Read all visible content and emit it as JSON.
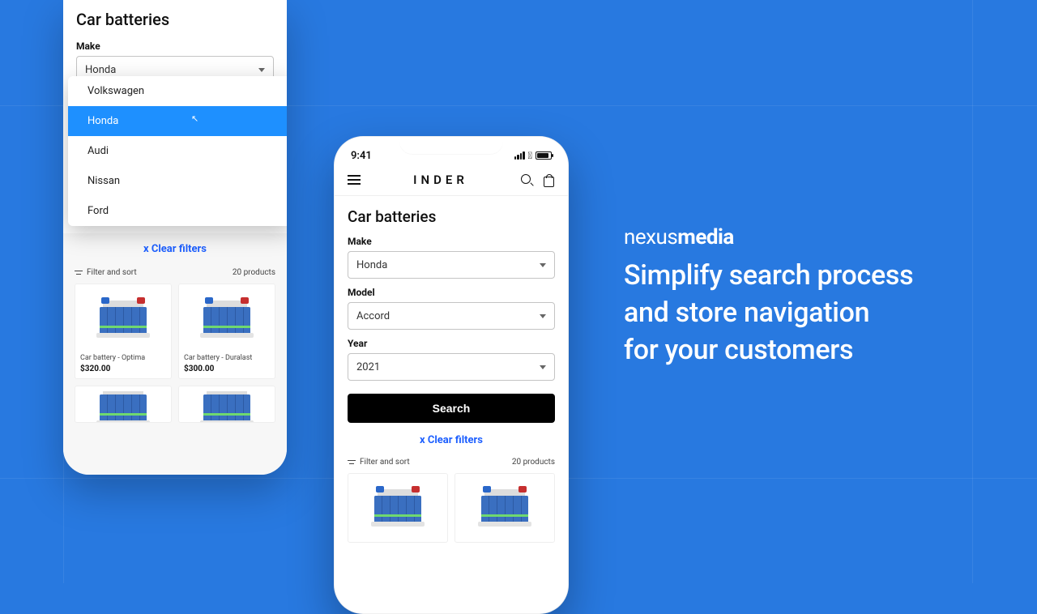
{
  "phone1": {
    "title": "Car batteries",
    "make_label": "Make",
    "make_value": "Honda",
    "dropdown": {
      "options": [
        "Volkswagen",
        "Honda",
        "Audi",
        "Nissan",
        "Ford"
      ],
      "selected_index": 1
    },
    "clear_filters": "x Clear filters",
    "filter_sort": "Filter and sort",
    "product_count": "20 products",
    "products": [
      {
        "name": "Car battery - Optima",
        "price": "$320.00"
      },
      {
        "name": "Car battery - Duralast",
        "price": "$300.00"
      }
    ]
  },
  "phone2": {
    "status_time": "9:41",
    "brand": "INDER",
    "title": "Car batteries",
    "fields": {
      "make": {
        "label": "Make",
        "value": "Honda"
      },
      "model": {
        "label": "Model",
        "value": "Accord"
      },
      "year": {
        "label": "Year",
        "value": "2021"
      }
    },
    "search_button": "Search",
    "clear_filters": "x Clear filters",
    "filter_sort": "Filter and sort",
    "product_count": "20 products"
  },
  "marketing": {
    "logo_prefix": "nexus",
    "logo_suffix": "media",
    "headline_l1": "Simplify search process",
    "headline_l2": "and store navigation",
    "headline_l3": "for your customers"
  }
}
